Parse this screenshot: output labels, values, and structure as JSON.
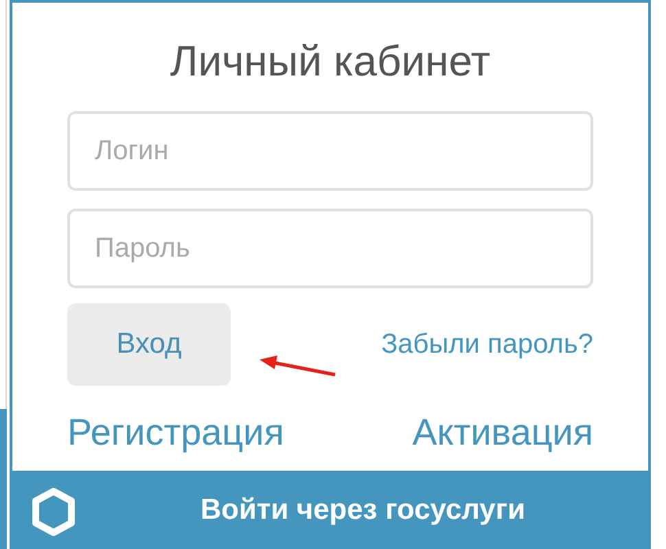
{
  "title": "Личный кабинет",
  "login": {
    "placeholder": "Логин"
  },
  "password": {
    "placeholder": "Пароль"
  },
  "login_button": "Вход",
  "forgot_link": "Забыли пароль?",
  "links": [
    "Регистрация",
    "Активация"
  ],
  "gosuslugi_button": "Войти через госуслуги"
}
